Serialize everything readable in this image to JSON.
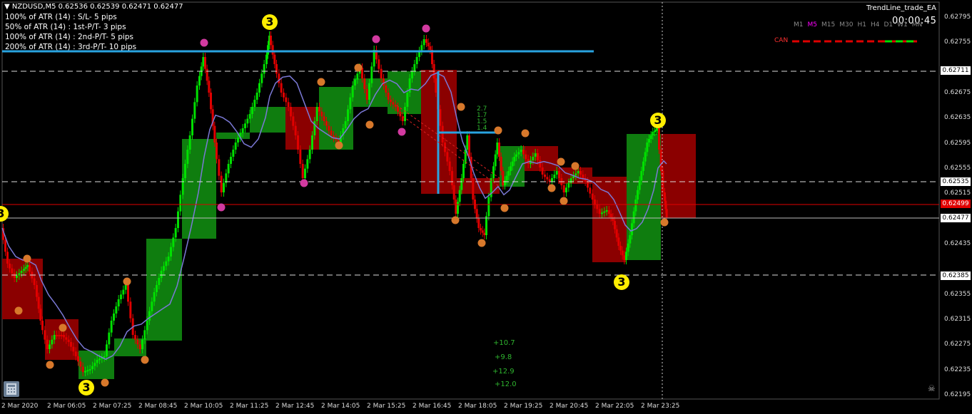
{
  "header": {
    "symbol_line": "NZDUSD,M5  0.62536 0.62539 0.62471 0.62477"
  },
  "info_lines": [
    "100% of ATR (14) :       S/L- 5 pips",
    "50% of ATR (14) : 1st-P/T- 3 pips",
    "100% of ATR (14) : 2nd-P/T- 5 pips",
    "200% of ATR (14) : 3rd-P/T- 10 pips"
  ],
  "ea": {
    "name": "TrendLine_trade_EA",
    "timer": "00:00:45",
    "timeframes": [
      "M1",
      "M5",
      "M15",
      "M30",
      "H1",
      "H4",
      "D1",
      "W1",
      "MN"
    ],
    "active_timeframe": "M5",
    "can_label": "CAN"
  },
  "price_axis": {
    "ticks": [
      "0.62795",
      "0.62755",
      "0.62711",
      "0.62675",
      "0.62635",
      "0.62595",
      "0.62555",
      "0.62535",
      "0.62515",
      "0.62499",
      "0.62477",
      "0.62435",
      "0.62385",
      "0.62355",
      "0.62315",
      "0.62275",
      "0.62235",
      "0.62195"
    ],
    "boxed": [
      "0.62711",
      "0.62535",
      "0.62477",
      "0.62385"
    ],
    "current": "0.62499"
  },
  "time_axis": [
    "2 Mar 2020",
    "2 Mar 06:05",
    "2 Mar 07:25",
    "2 Mar 08:45",
    "2 Mar 10:05",
    "2 Mar 11:25",
    "2 Mar 12:45",
    "2 Mar 14:05",
    "2 Mar 15:25",
    "2 Mar 16:45",
    "2 Mar 18:05",
    "2 Mar 19:25",
    "2 Mar 20:45",
    "2 Mar 22:05",
    "2 Mar 23:25"
  ],
  "profit_labels": [
    "+10.7",
    "+9.8",
    "+12.9",
    "+12.0"
  ],
  "small_labels": [
    "2.7",
    "1.7",
    "1.5",
    "1.4"
  ],
  "wave_label": "3",
  "colors": {
    "bull_candle": "#00e000",
    "bear_candle": "#e00000",
    "bull_box": "#0f7d0f",
    "bear_box": "#8b0000",
    "ma_line": "#7b79d6",
    "trend_line": "#29a3e0",
    "wave_marker": "#ffee00",
    "fractal_orange": "#d7782b",
    "fractal_pink": "#d23aa0"
  },
  "icons": {
    "calculator": "calculator-icon",
    "skull": "skull-icon"
  }
}
